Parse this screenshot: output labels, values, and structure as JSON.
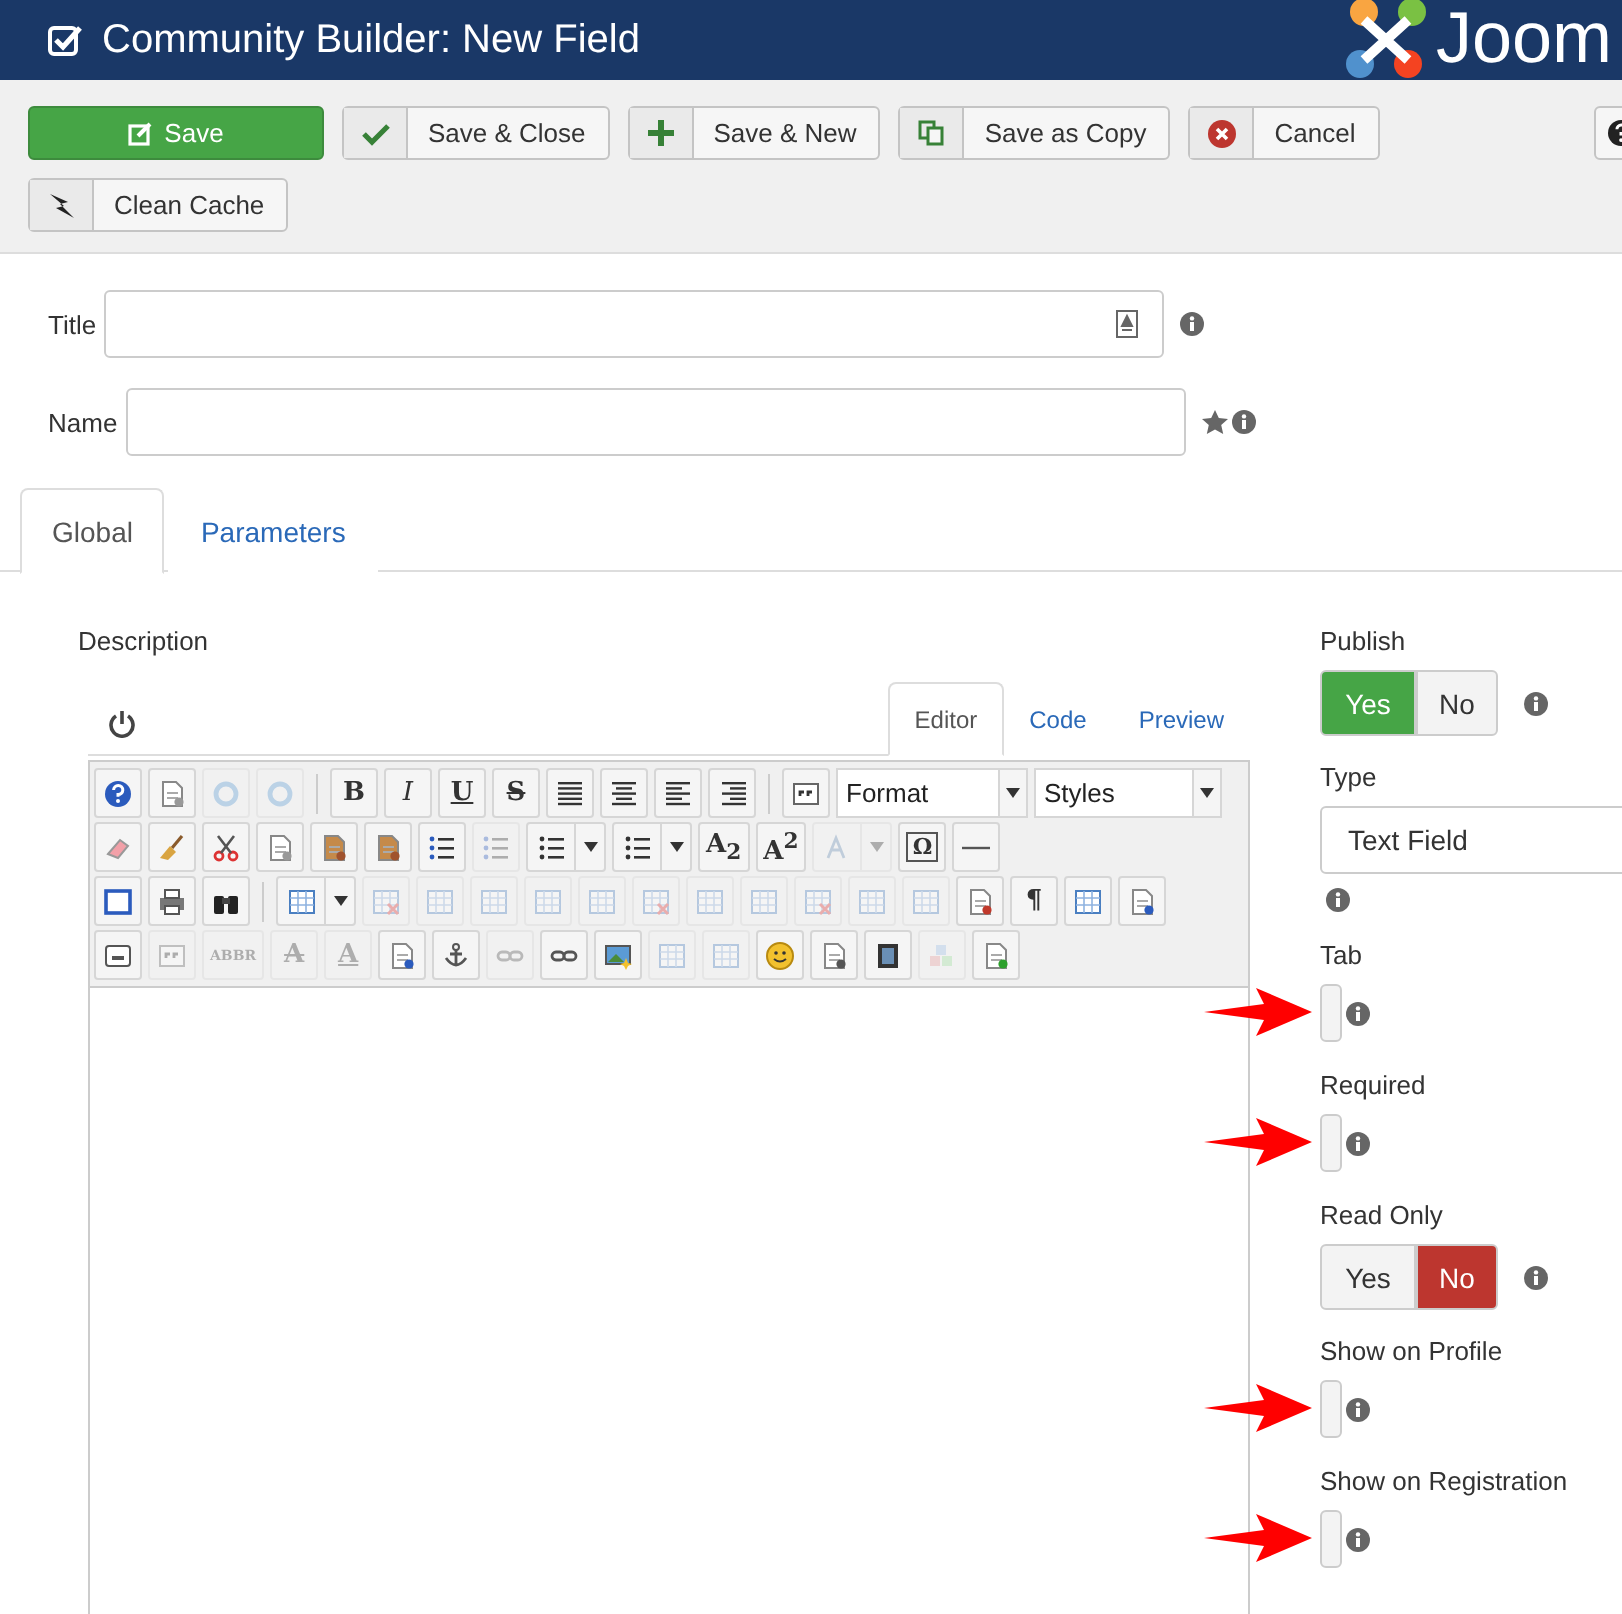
{
  "header": {
    "title": "Community Builder: New Field",
    "logo_text": "Joom"
  },
  "toolbar": {
    "rows": [
      [
        {
          "label": "Save",
          "kind": "primary"
        },
        {
          "label": "Save & Close",
          "kind": "default"
        },
        {
          "label": "Save & New",
          "kind": "default"
        },
        {
          "label": "Save as Copy",
          "kind": "default"
        },
        {
          "label": "Cancel",
          "kind": "default"
        }
      ],
      [
        {
          "label": "Clean Cache",
          "kind": "default"
        }
      ]
    ]
  },
  "form": {
    "fields": [
      {
        "label": "Title",
        "required": false
      },
      {
        "label": "Name",
        "required": true
      }
    ]
  },
  "tabs": [
    {
      "label": "Global",
      "selected": true
    },
    {
      "label": "Parameters",
      "selected": false
    }
  ],
  "description": {
    "label": "Description",
    "editor_tabs": [
      {
        "label": "Editor",
        "selected": true
      },
      {
        "label": "Code",
        "selected": false
      },
      {
        "label": "Preview",
        "selected": false
      }
    ],
    "toolbar": [
      [
        {
          "kind": "icon",
          "disabled": false
        },
        {
          "kind": "icon",
          "disabled": false
        },
        {
          "kind": "icon",
          "disabled": true
        },
        {
          "kind": "icon",
          "disabled": true
        },
        {
          "kind": "separator"
        },
        {
          "kind": "glyph",
          "text": "B",
          "disabled": false
        },
        {
          "kind": "glyph",
          "text": "I",
          "disabled": false
        },
        {
          "kind": "glyph",
          "text": "U",
          "disabled": false
        },
        {
          "kind": "glyph",
          "text": "S",
          "disabled": false
        },
        {
          "kind": "icon",
          "disabled": false
        },
        {
          "kind": "icon",
          "disabled": false
        },
        {
          "kind": "icon",
          "disabled": false
        },
        {
          "kind": "icon",
          "disabled": false
        },
        {
          "kind": "separator"
        },
        {
          "kind": "icon",
          "disabled": false
        },
        {
          "kind": "select",
          "label": "Format"
        },
        {
          "kind": "select",
          "label": "Styles"
        }
      ],
      [
        {
          "kind": "icon",
          "disabled": false
        },
        {
          "kind": "icon",
          "disabled": false
        },
        {
          "kind": "icon",
          "disabled": false
        },
        {
          "kind": "icon",
          "disabled": false
        },
        {
          "kind": "icon",
          "disabled": false
        },
        {
          "kind": "icon",
          "disabled": false
        },
        {
          "kind": "icon",
          "disabled": false
        },
        {
          "kind": "icon",
          "disabled": true
        },
        {
          "kind": "split",
          "disabled": false
        },
        {
          "kind": "split",
          "disabled": false
        },
        {
          "kind": "glyph",
          "text": "A$_{2}$",
          "disabled": false
        },
        {
          "kind": "glyph",
          "text": "A$^{2}$",
          "disabled": false
        },
        {
          "kind": "split",
          "disabled": true
        },
        {
          "kind": "glyph",
          "text": "Ω",
          "disabled": false
        },
        {
          "kind": "icon",
          "disabled": false
        }
      ],
      [
        {
          "kind": "icon",
          "disabled": false
        },
        {
          "kind": "icon",
          "disabled": false
        },
        {
          "kind": "icon",
          "disabled": false
        },
        {
          "kind": "separator"
        },
        {
          "kind": "split",
          "disabled": false
        },
        {
          "kind": "icon",
          "disabled": true
        },
        {
          "kind": "icon",
          "disabled": true
        },
        {
          "kind": "icon",
          "disabled": true
        },
        {
          "kind": "icon",
          "disabled": true
        },
        {
          "kind": "icon",
          "disabled": true
        },
        {
          "kind": "icon",
          "disabled": true
        },
        {
          "kind": "icon",
          "disabled": true
        },
        {
          "kind": "icon",
          "disabled": true
        },
        {
          "kind": "icon",
          "disabled": true
        },
        {
          "kind": "icon",
          "disabled": true
        },
        {
          "kind": "icon",
          "disabled": true
        },
        {
          "kind": "icon",
          "disabled": false
        },
        {
          "kind": "glyph",
          "text": "¶",
          "disabled": false
        },
        {
          "kind": "icon",
          "disabled": false
        },
        {
          "kind": "icon",
          "disabled": false
        }
      ],
      [
        {
          "kind": "icon",
          "disabled": false
        },
        {
          "kind": "icon",
          "disabled": true
        },
        {
          "kind": "glyph",
          "text": "ABBR",
          "disabled": true
        },
        {
          "kind": "glyph",
          "text": "A",
          "disabled": true
        },
        {
          "kind": "glyph",
          "text": "A",
          "disabled": true
        },
        {
          "kind": "icon",
          "disabled": false
        },
        {
          "kind": "icon",
          "disabled": false
        },
        {
          "kind": "icon",
          "disabled": true
        },
        {
          "kind": "icon",
          "disabled": false
        },
        {
          "kind": "icon",
          "disabled": false
        },
        {
          "kind": "icon",
          "disabled": true
        },
        {
          "kind": "icon",
          "disabled": true
        },
        {
          "kind": "icon",
          "disabled": false
        },
        {
          "kind": "icon",
          "disabled": false
        },
        {
          "kind": "icon",
          "disabled": false
        },
        {
          "kind": "icon",
          "disabled": true
        },
        {
          "kind": "icon",
          "disabled": false
        }
      ]
    ]
  },
  "options": [
    {
      "label": "Publish",
      "kind": "toggle",
      "marked": false,
      "options": [
        {
          "label": "Yes",
          "selected": true
        },
        {
          "label": "No",
          "selected": false
        }
      ]
    },
    {
      "label": "Type",
      "kind": "select",
      "marked": false,
      "value": "Text Field"
    },
    {
      "label": "Tab",
      "kind": "empty",
      "marked": true
    },
    {
      "label": "Required",
      "kind": "empty",
      "marked": true
    },
    {
      "label": "Read Only",
      "kind": "toggle",
      "marked": false,
      "options": [
        {
          "label": "Yes",
          "selected": false
        },
        {
          "label": "No",
          "selected": true
        }
      ]
    },
    {
      "label": "Show on Profile",
      "kind": "empty",
      "marked": true
    },
    {
      "label": "Show on Registration",
      "kind": "empty",
      "marked": true
    }
  ]
}
